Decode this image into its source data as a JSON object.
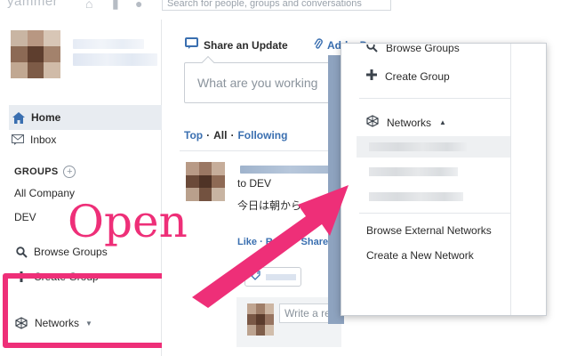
{
  "app": {
    "logo": "yammer",
    "search_placeholder": "Search for people, groups and conversations"
  },
  "sidebar": {
    "home_label": "Home",
    "inbox_label": "Inbox",
    "groups_heading": "GROUPS",
    "groups": [
      "All Company",
      "DEV"
    ],
    "browse_groups_label": "Browse Groups",
    "create_group_label": "Create Group",
    "networks_label": "Networks"
  },
  "feed": {
    "share_tab_label": "Share an Update",
    "file_tab_label": "Add a Doc",
    "compose_placeholder": "What are you working",
    "filters": [
      "Top",
      "All",
      "Following"
    ],
    "active_filter": "All",
    "post_to": "to DEV",
    "post_body": "今日は朝から",
    "post_actions": "Like · Reply · Share",
    "reply_placeholder": "Write a reply"
  },
  "dropdown": {
    "browse_groups_label": "Browse Groups",
    "create_group_label": "Create Group",
    "networks_label": "Networks",
    "browse_external_label": "Browse External Networks",
    "create_network_label": "Create a New Network"
  },
  "annotation": {
    "text": "Open",
    "color": "#ee2f78"
  },
  "colors": {
    "link": "#3a6fb0",
    "highlight": "#ee2f78",
    "home_bg": "#e8ecf1"
  }
}
